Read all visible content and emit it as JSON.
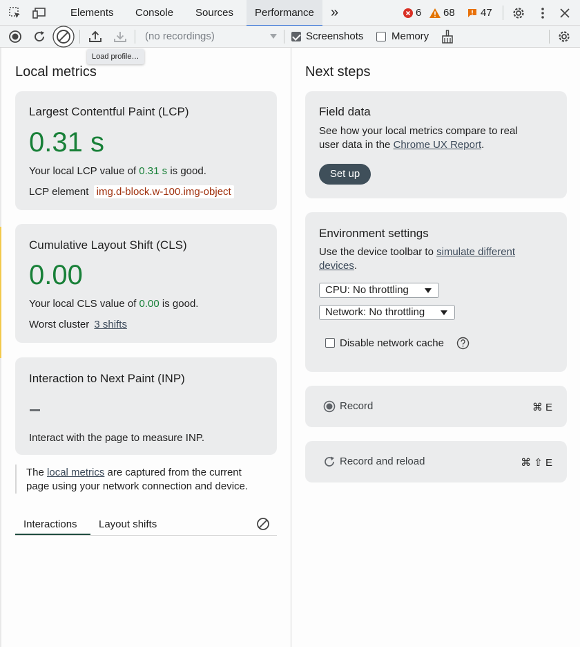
{
  "tabs": {
    "elements": "Elements",
    "console": "Console",
    "sources": "Sources",
    "performance": "Performance",
    "more": "»"
  },
  "badges": {
    "errors": "6",
    "warnings": "68",
    "issues": "47"
  },
  "toolbar": {
    "recording_select": "(no recordings)",
    "screenshots_label": "Screenshots",
    "memory_label": "Memory",
    "load_tooltip": "Load profile…"
  },
  "local_metrics": {
    "heading": "Local metrics",
    "lcp": {
      "title": "Largest Contentful Paint (LCP)",
      "value": "0.31 s",
      "desc_prefix": "Your local LCP value of ",
      "desc_value": "0.31 s",
      "desc_suffix": " is good.",
      "element_label": "LCP element",
      "element_value": "img.d-block.w-100.img-object"
    },
    "cls": {
      "title": "Cumulative Layout Shift (CLS)",
      "value": "0.00",
      "desc_prefix": "Your local CLS value of ",
      "desc_value": "0.00",
      "desc_suffix": " is good.",
      "cluster_label": "Worst cluster",
      "cluster_link": "3 shifts"
    },
    "inp": {
      "title": "Interaction to Next Paint (INP)",
      "value": "–",
      "desc": "Interact with the page to measure INP."
    },
    "note_prefix": "The ",
    "note_link": "local metrics",
    "note_suffix_1": " are captured from the current",
    "note_line2": "page using your network connection and device.",
    "tab_interactions": "Interactions",
    "tab_layout_shifts": "Layout shifts"
  },
  "next_steps": {
    "heading": "Next steps",
    "field": {
      "title": "Field data",
      "line1": "See how your local metrics compare to real",
      "line2_prefix": "user data in the ",
      "line2_link": "Chrome UX Report",
      "line2_suffix": ".",
      "button": "Set up"
    },
    "env": {
      "title": "Environment settings",
      "line1_prefix": "Use the device toolbar to ",
      "line1_link": "simulate different",
      "line2_link": "devices",
      "line2_suffix": ".",
      "cpu": "CPU: No throttling",
      "network": "Network: No throttling",
      "cache_label": "Disable network cache"
    },
    "record": {
      "label": "Record",
      "shortcut": "⌘ E"
    },
    "reload": {
      "label": "Record and reload",
      "shortcut": "⌘ ⇧ E"
    }
  }
}
